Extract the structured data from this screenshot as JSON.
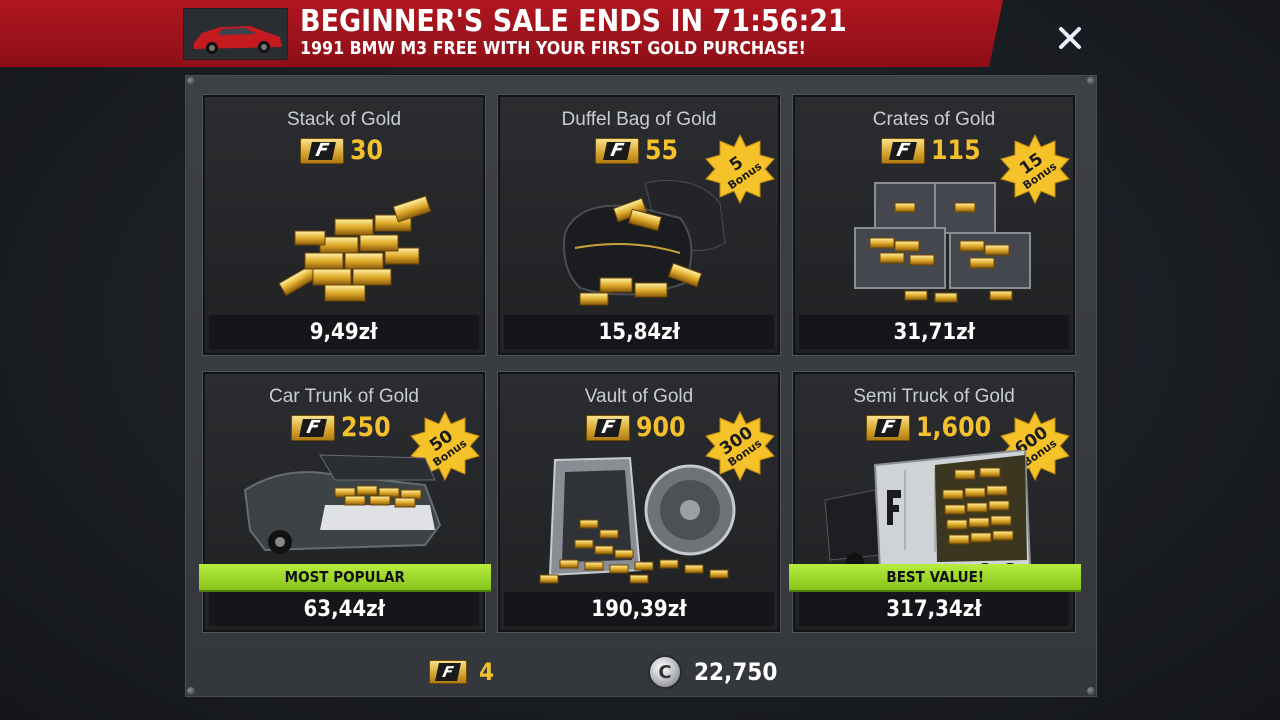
{
  "banner": {
    "title": "BEGINNER'S SALE ENDS IN 71:56:21",
    "subtitle": "1991 BMW M3 FREE WITH YOUR FIRST GOLD PURCHASE!",
    "close_icon": "close-icon"
  },
  "currency_logo": "F",
  "coin_logo": "C",
  "packs": [
    {
      "name": "Stack of Gold",
      "amount": "30",
      "price": "9,49zł",
      "bonus_num": "",
      "bonus_word": "",
      "ribbon": ""
    },
    {
      "name": "Duffel Bag of Gold",
      "amount": "55",
      "price": "15,84zł",
      "bonus_num": "5",
      "bonus_word": "Bonus",
      "ribbon": ""
    },
    {
      "name": "Crates of Gold",
      "amount": "115",
      "price": "31,71zł",
      "bonus_num": "15",
      "bonus_word": "Bonus",
      "ribbon": ""
    },
    {
      "name": "Car Trunk of Gold",
      "amount": "250",
      "price": "63,44zł",
      "bonus_num": "50",
      "bonus_word": "Bonus",
      "ribbon": "MOST POPULAR"
    },
    {
      "name": "Vault of Gold",
      "amount": "900",
      "price": "190,39zł",
      "bonus_num": "300",
      "bonus_word": "Bonus",
      "ribbon": ""
    },
    {
      "name": "Semi Truck of Gold",
      "amount": "1,600",
      "price": "317,34zł",
      "bonus_num": "600",
      "bonus_word": "Bonus",
      "ribbon": "BEST VALUE!"
    }
  ],
  "footer": {
    "gold_balance": "4",
    "credits_balance": "22,750"
  },
  "colors": {
    "banner_red": "#a0121b",
    "gold_text": "#f4c12c",
    "ribbon_green": "#9fd92c",
    "bonus_star": "#f5c22a"
  }
}
